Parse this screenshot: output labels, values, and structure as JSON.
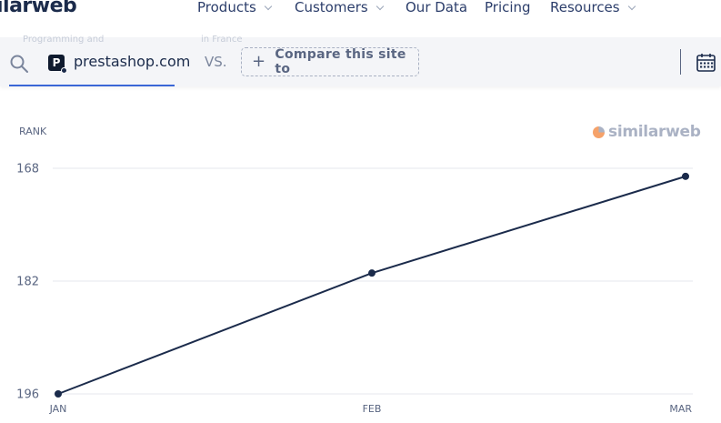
{
  "nav": {
    "logo": "ilarweb",
    "items": [
      {
        "label": "Products",
        "has_menu": true
      },
      {
        "label": "Customers",
        "has_menu": true
      },
      {
        "label": "Our Data",
        "has_menu": false
      },
      {
        "label": "Pricing",
        "has_menu": false
      },
      {
        "label": "Resources",
        "has_menu": true
      }
    ]
  },
  "compare": {
    "ghost_left": "Programming and",
    "ghost_right": "in France",
    "site": "prestashop.com",
    "site_icon_letter": "P",
    "vs": "VS.",
    "button_label": "Compare this site to",
    "search_icon": "search-icon",
    "calendar_icon": "calendar-icon"
  },
  "brand": {
    "watermark": "similarweb",
    "accent": "#3a66d6",
    "line_color": "#1b2b4b",
    "orange": "#f5a26a"
  },
  "chart_data": {
    "type": "line",
    "ylabel": "RANK",
    "categories": [
      "JAN",
      "FEB",
      "MAR"
    ],
    "series": [
      {
        "values": [
          196,
          181,
          169
        ]
      }
    ],
    "y_ticks": [
      168,
      182,
      196
    ],
    "ylim": [
      196,
      167
    ],
    "y_inverted": true,
    "grid": true
  }
}
